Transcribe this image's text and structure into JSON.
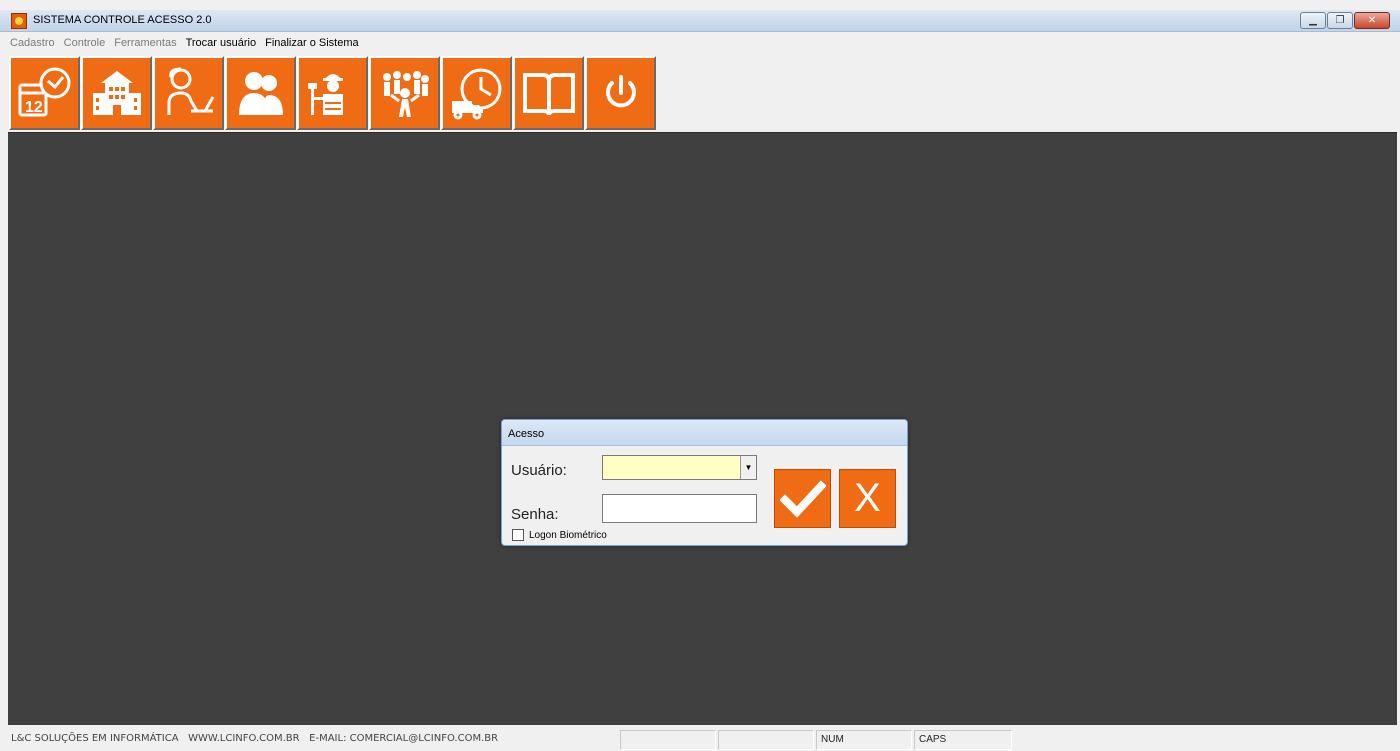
{
  "window": {
    "title": "SISTEMA CONTROLE ACESSO 2.0",
    "icon": "app-logo-icon"
  },
  "menu": {
    "items": [
      {
        "label": "Cadastro",
        "enabled": false
      },
      {
        "label": "Controle",
        "enabled": false
      },
      {
        "label": "Ferramentas",
        "enabled": false
      },
      {
        "label": "Trocar usuário",
        "enabled": true
      },
      {
        "label": "Finalizar o Sistema",
        "enabled": true
      }
    ]
  },
  "toolbar": {
    "color": "#ef6b14",
    "buttons": [
      {
        "icon": "calendar-clock-icon"
      },
      {
        "icon": "building-icon"
      },
      {
        "icon": "receptionist-icon"
      },
      {
        "icon": "people-icon"
      },
      {
        "icon": "worker-icon"
      },
      {
        "icon": "crowd-icon"
      },
      {
        "icon": "delivery-truck-clock-icon"
      },
      {
        "icon": "book-icon"
      },
      {
        "icon": "power-icon"
      }
    ]
  },
  "dialog": {
    "title": "Acesso",
    "user_label": "Usuário:",
    "user_value": "",
    "password_label": "Senha:",
    "password_value": "",
    "biometric_label": "Logon Biométrico",
    "biometric_checked": false,
    "cancel_glyph": "X"
  },
  "statusbar": {
    "info": "L&C SOLUÇÕES EM INFORMÁTICA   WWW.LCINFO.COM.BR   E-MAIL: COMERCIAL@LCINFO.COM.BR",
    "num": "NUM",
    "caps": "CAPS"
  }
}
